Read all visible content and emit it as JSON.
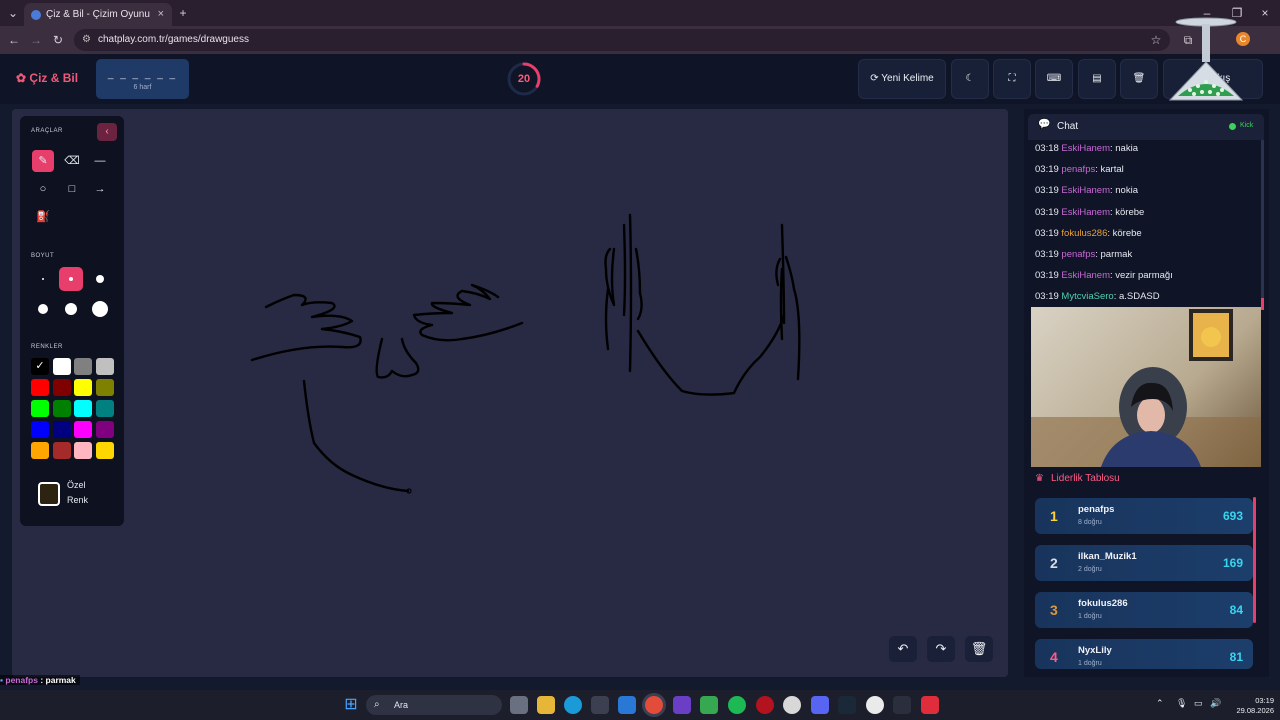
{
  "browser": {
    "tab_title": "Çiz & Bil - Çizim Oyunu",
    "url": "chatplay.com.tr/games/drawguess",
    "profile_initial": "C"
  },
  "header": {
    "logo": "Çiz & Bil",
    "word_dashes": "_ _ _ _ _ _",
    "letter_count": "6 harf",
    "timer": "20",
    "timer_progress": 0.33,
    "new_word": "Yeni Kelime",
    "exit": "Çıkış"
  },
  "tools": {
    "tools_label": "ARAÇLAR",
    "size_label": "BOYUT",
    "colors_label": "RENKLER",
    "custom_color_label": "Özel Renk",
    "active_tool": "pen",
    "active_size": 2,
    "colors": [
      "#000000",
      "#ffffff",
      "#808080",
      "#c0c0c0",
      "#ff0000",
      "#800000",
      "#ffff00",
      "#808000",
      "#00ff00",
      "#008000",
      "#00ffff",
      "#008080",
      "#0000ff",
      "#000080",
      "#ff00ff",
      "#800080",
      "#ffa500",
      "#a52a2a",
      "#ffb6c1",
      "#ffd700"
    ]
  },
  "chat": {
    "title": "Chat",
    "platform": "Kick",
    "messages": [
      {
        "time": "03:18",
        "user": "EskiHanem",
        "color": "#c86bd6",
        "text": "nakia"
      },
      {
        "time": "03:19",
        "user": "penafps",
        "color": "#c86bd6",
        "text": "kartal"
      },
      {
        "time": "03:19",
        "user": "EskiHanem",
        "color": "#c86bd6",
        "text": "nokia"
      },
      {
        "time": "03:19",
        "user": "EskiHanem",
        "color": "#c86bd6",
        "text": "körebe"
      },
      {
        "time": "03:19",
        "user": "fokulus286",
        "color": "#e8a13a",
        "text": "körebe"
      },
      {
        "time": "03:19",
        "user": "penafps",
        "color": "#c86bd6",
        "text": "parmak"
      },
      {
        "time": "03:19",
        "user": "EskiHanem",
        "color": "#c86bd6",
        "text": "vezir parmağı"
      },
      {
        "time": "03:19",
        "user": "MytcviaSero",
        "color": "#4fd1b0",
        "text": "a.SDASD"
      }
    ]
  },
  "leaderboard": {
    "title": "Liderlik Tablosu",
    "rows": [
      {
        "rank": "1",
        "name": "penafps",
        "sub": "8 doğru",
        "score": "693",
        "rank_color": "#ffd23a"
      },
      {
        "rank": "2",
        "name": "ilkan_Muzik1",
        "sub": "2 doğru",
        "score": "169",
        "rank_color": "#d8dce6"
      },
      {
        "rank": "3",
        "name": "fokulus286",
        "sub": "1 doğru",
        "score": "84",
        "rank_color": "#e0963a"
      },
      {
        "rank": "4",
        "name": "NyxLily",
        "sub": "1 doğru",
        "score": "81",
        "rank_color": "#ff5c86"
      }
    ]
  },
  "overlay": [
    {
      "user": "penafps",
      "text": ": parmak"
    },
    {
      "user": "EskiHanem",
      "text": ": vezir parmağı"
    },
    {
      "user": "MytcviaSero",
      "text": ": a.SDASD"
    }
  ],
  "taskbar": {
    "search": "Ara",
    "time": "03:19",
    "date": "29.08.2026"
  }
}
